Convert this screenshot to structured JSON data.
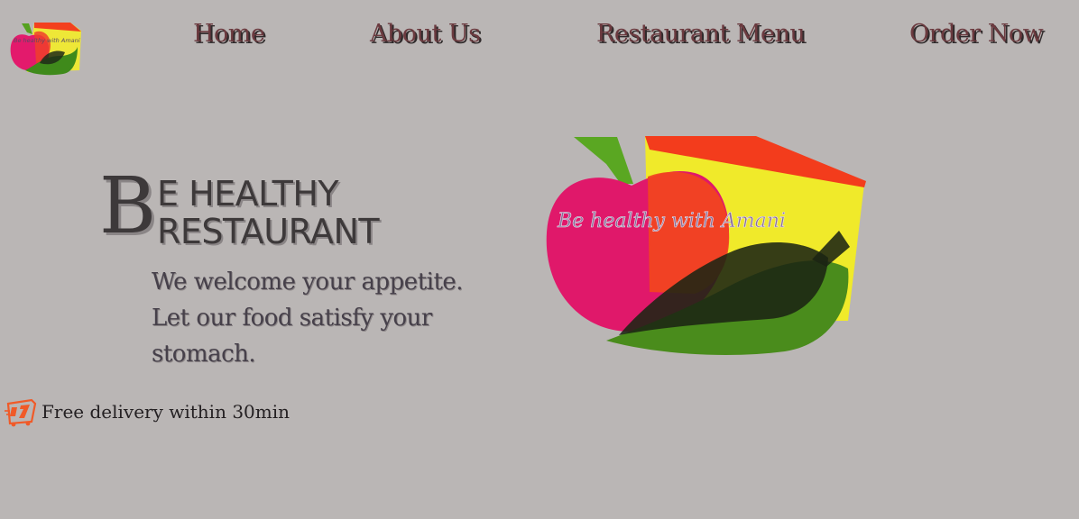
{
  "nav": {
    "logo_text": "Be healthy with Amani",
    "links": [
      {
        "label": "Home"
      },
      {
        "label": "About Us"
      },
      {
        "label": "Restaurant Menu"
      },
      {
        "label": "Order Now"
      }
    ]
  },
  "hero": {
    "title_initial": "B",
    "title_line_1": "E HEALTHY",
    "title_line_2": "RESTAURANT",
    "tagline": "We welcome your appetite. Let our food satisfy your stomach.",
    "logo_text": "Be healthy with Amani"
  },
  "delivery": {
    "icon": "delivery-truck-icon",
    "text": "Free delivery within 30min"
  },
  "colors": {
    "background": "#bab6b5",
    "nav_text": "#6b3a3f",
    "title_text": "#3d393a",
    "apple_pink": "#e0186a",
    "cheese_yellow": "#f0ea2a",
    "cheese_red": "#f33c1c",
    "leaf_green": "#4a8c1c",
    "delivery_orange": "#f05a28"
  }
}
